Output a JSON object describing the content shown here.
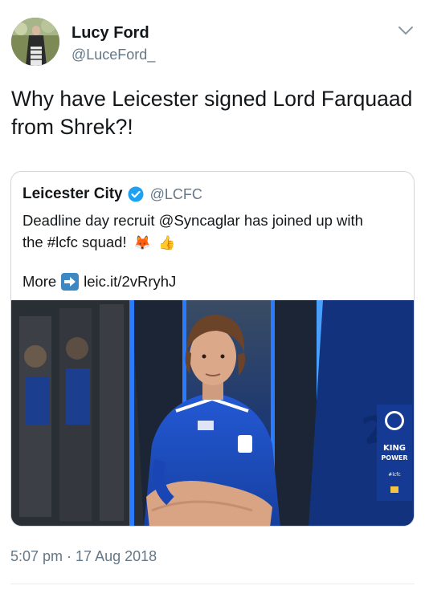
{
  "author": {
    "name": "Lucy Ford",
    "handle": "@LuceFord_"
  },
  "tweet": {
    "text": "Why have Leicester signed Lord Farquaad from Shrek?!",
    "timestamp": "5:07 pm · 17 Aug 2018"
  },
  "quoted": {
    "name": "Leicester City",
    "handle": "@LCFC",
    "text_line1": "Deadline day recruit @Syncaglar has joined up with",
    "text_line2": "the #lcfc squad!",
    "emoji_1": "🦊",
    "emoji_2": "👍",
    "more_label": "More",
    "link": "leic.it/2vRryhJ",
    "image": {
      "sponsor_line1": "KING",
      "sponsor_line2": "POWER",
      "hashtag": "#lcfc",
      "shirt_number": "25"
    }
  },
  "colors": {
    "primary_text": "#14171a",
    "secondary_text": "#657786",
    "verified_blue": "#1da1f2",
    "border": "#ccd6dd",
    "kit_blue": "#1b4fc4"
  },
  "icons": {
    "menu": "chevron-down-icon",
    "verified": "verified-badge-icon",
    "link_arrow": "right-arrow-emoji-icon"
  }
}
